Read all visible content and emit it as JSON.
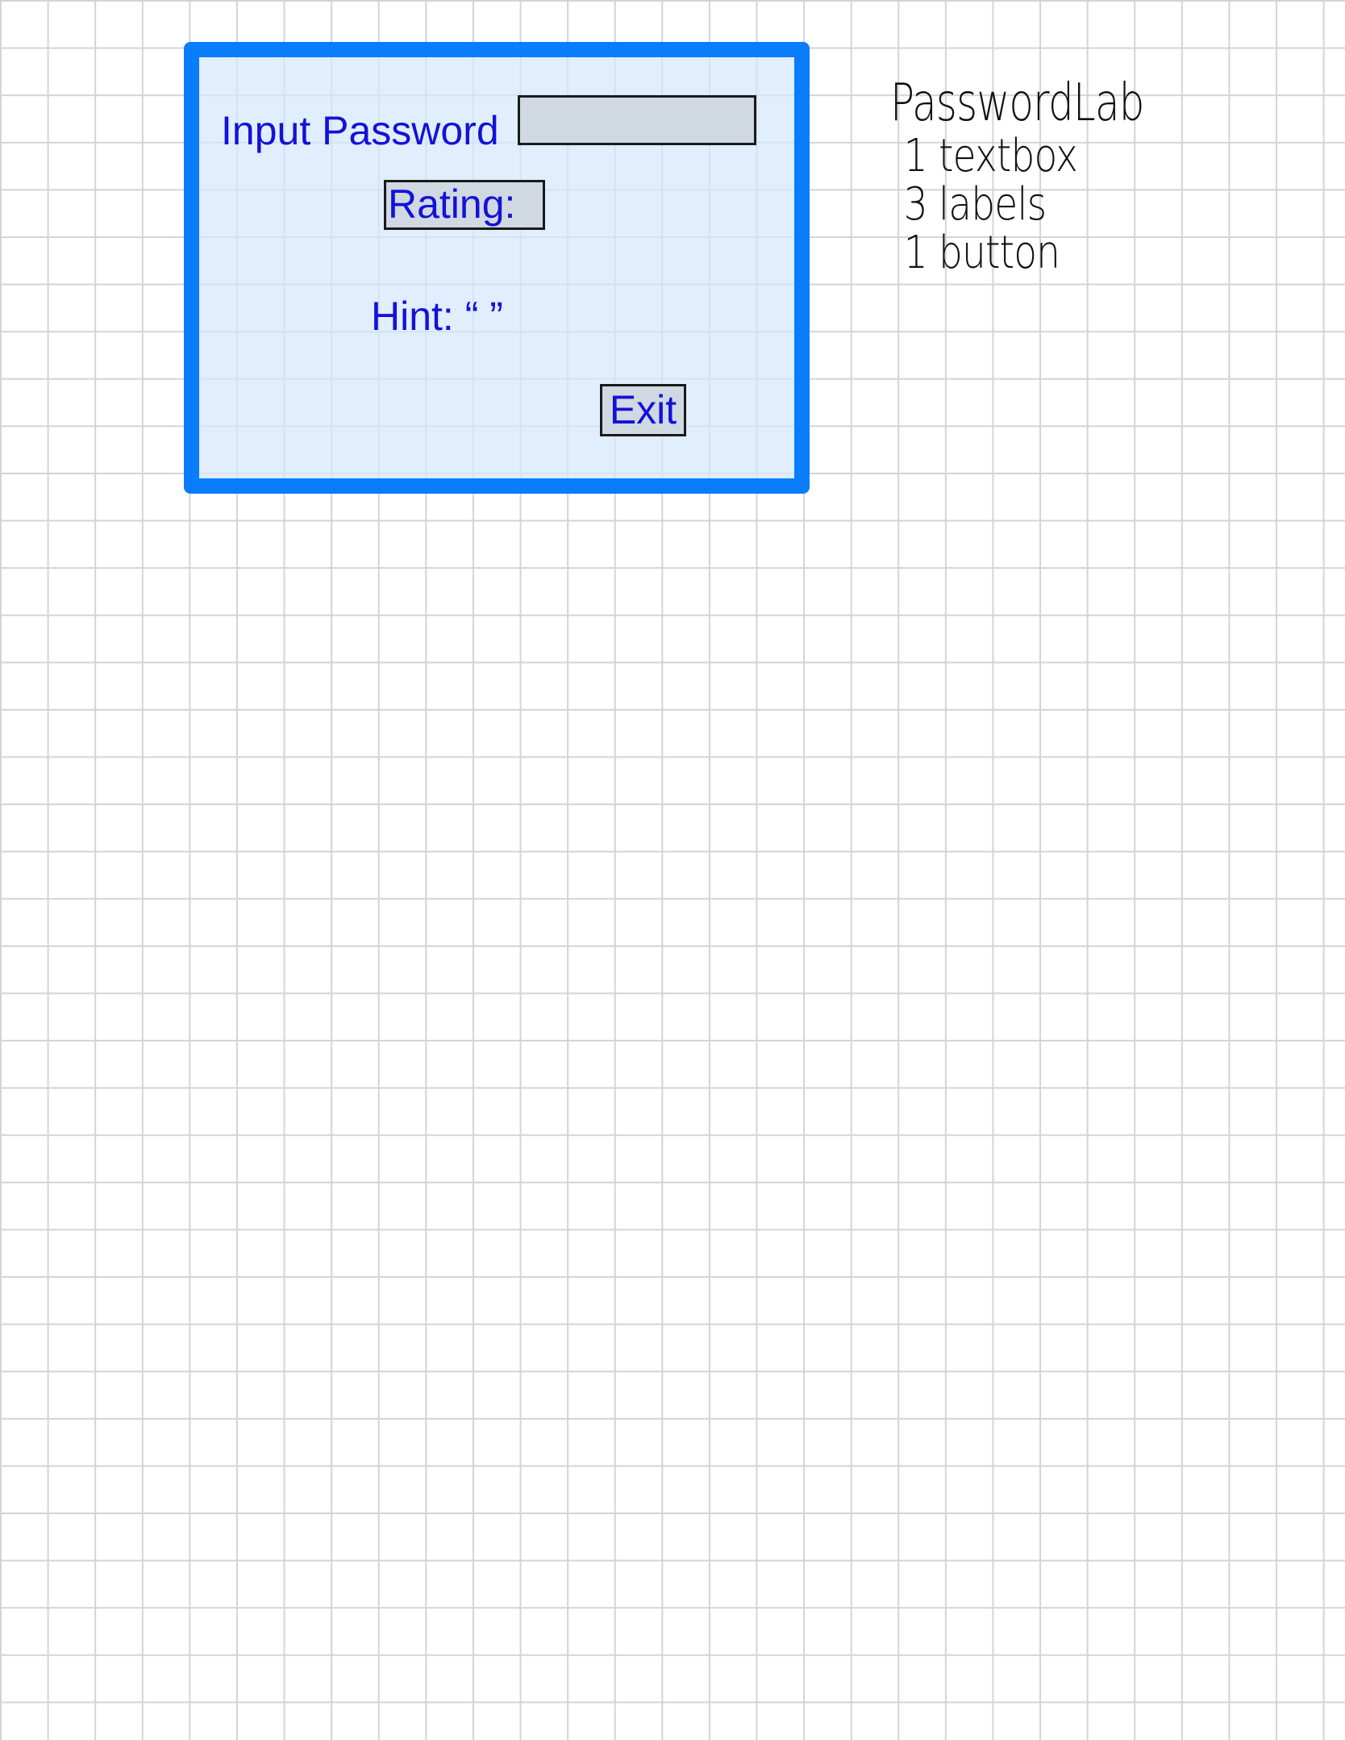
{
  "form": {
    "password_label": "Input Password",
    "password_value": "",
    "rating_label": "Rating:",
    "hint_label": "Hint: “ ”",
    "exit_button_label": "Exit"
  },
  "notes": {
    "title": "PasswordLab",
    "items": [
      "1 textbox",
      "3 labels",
      "1 button"
    ]
  },
  "colors": {
    "form_border": "#0a7dfb",
    "form_background": "#d6e8fc",
    "control_text": "#1212d8",
    "control_background": "#d0d8e2",
    "grid_line": "#d4d4d4"
  }
}
